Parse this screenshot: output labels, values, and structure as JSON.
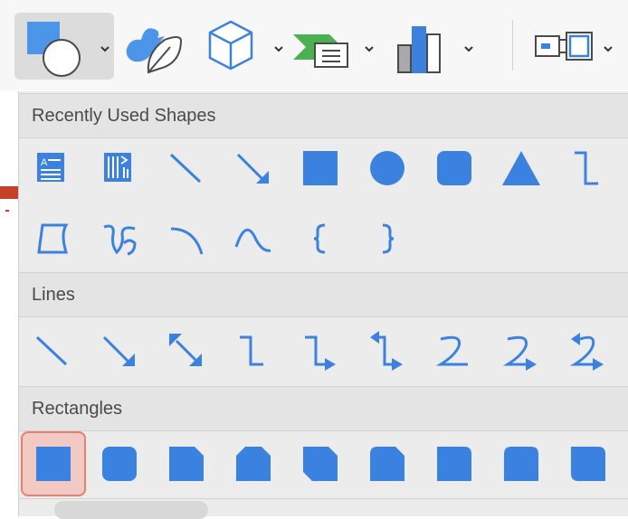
{
  "toolbar": {
    "items": [
      {
        "name": "shapes",
        "icon": "shapes-icon",
        "active": true
      },
      {
        "name": "icons",
        "icon": "bird-leaf-icon"
      },
      {
        "name": "3d-models",
        "icon": "cube-icon"
      },
      {
        "name": "smartart",
        "icon": "smartart-icon"
      },
      {
        "name": "chart",
        "icon": "chart-icon"
      },
      {
        "name": "screenshot",
        "icon": "screenshot-icon"
      }
    ]
  },
  "dropdown": {
    "sections": [
      {
        "title": "Recently Used Shapes"
      },
      {
        "title": "Lines"
      },
      {
        "title": "Rectangles"
      }
    ]
  },
  "colors": {
    "shape_blue": "#3b82e0",
    "selected_bg": "#f2c9c3",
    "selected_border": "#e4806f",
    "panel_bg": "#ececec"
  }
}
